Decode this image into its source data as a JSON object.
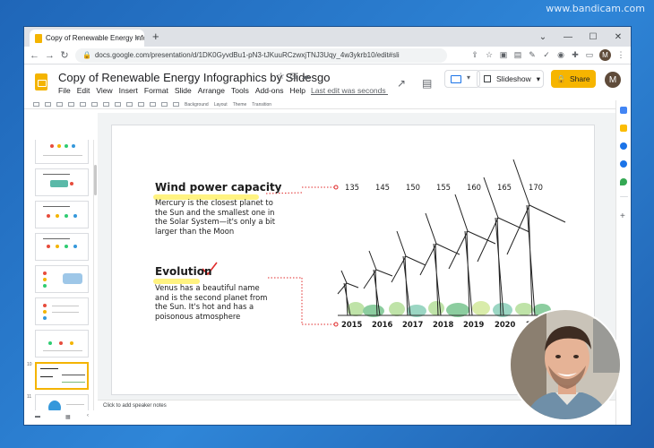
{
  "watermark": "www.bandicam.com",
  "browser": {
    "tab_title": "Copy of Renewable Energy Infog",
    "tab_close": "×",
    "new_tab": "+",
    "url": "docs.google.com/presentation/d/1DK0GyvdBu1-pN3-tJKuuRCzwxjTNJ3Uqy_4w3ykrb10/edit#sli",
    "profile_initial": "M"
  },
  "doc": {
    "title": "Copy of Renewable Energy Infographics by Slidesgo",
    "menu": [
      "File",
      "Edit",
      "View",
      "Insert",
      "Format",
      "Slide",
      "Arrange",
      "Tools",
      "Add-ons",
      "Help"
    ],
    "last_edit": "Last edit was seconds ago",
    "slideshow_label": "Slideshow",
    "share_label": "Share",
    "user_initial": "M"
  },
  "toolbar": {
    "background_label": "Background",
    "layout_label": "Layout",
    "theme_label": "Theme",
    "transition_label": "Transition"
  },
  "filmstrip": {
    "numbers": [
      "",
      "",
      "",
      "",
      "",
      "",
      "",
      "10",
      "11",
      "",
      ""
    ],
    "selected_index": 7
  },
  "slide": {
    "section1": {
      "heading": "Wind power capacity",
      "body_lines": [
        "Mercury is the closest planet to",
        "the Sun and the smallest one in",
        "the Solar System—it's only a bit",
        "larger than the Moon"
      ]
    },
    "section2": {
      "heading": "Evolution",
      "body_lines": [
        "Venus has a beautiful name",
        "and is the second planet from",
        "the Sun. It's hot and has a",
        "poisonous atmosphere"
      ]
    },
    "capacity_ticks": [
      "135",
      "145",
      "150",
      "155",
      "160",
      "165",
      "170"
    ],
    "years": [
      "2015",
      "2016",
      "2017",
      "2018",
      "2019",
      "2020",
      "2021"
    ],
    "accent_color": "#e02b2b",
    "highlight_color": "#fff27a"
  },
  "speaker_notes_placeholder": "Click to add speaker notes"
}
